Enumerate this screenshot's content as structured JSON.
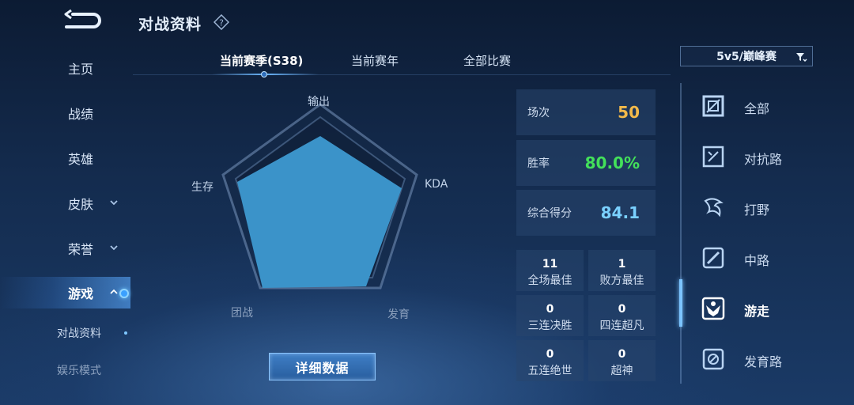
{
  "header": {
    "title": "对战资料"
  },
  "nav": {
    "items": [
      {
        "label": "主页"
      },
      {
        "label": "战绩"
      },
      {
        "label": "英雄"
      },
      {
        "label": "皮肤"
      },
      {
        "label": "荣誉"
      },
      {
        "label": "游戏"
      }
    ],
    "sub_items": [
      {
        "label": "对战资料"
      },
      {
        "label": "娱乐模式"
      }
    ]
  },
  "tabs": [
    {
      "label": "当前赛季(S38)"
    },
    {
      "label": "当前赛年"
    },
    {
      "label": "全部比赛"
    }
  ],
  "mode_select": {
    "value": "5v5/巅峰赛"
  },
  "radar": {
    "axes": [
      "输出",
      "KDA",
      "发育",
      "团战",
      "生存"
    ],
    "fill_color": "#3b93c9"
  },
  "detail_button": {
    "label": "详细数据"
  },
  "stats": {
    "matches": {
      "label": "场次",
      "value": "50",
      "color": "#f2b94a"
    },
    "win_rate": {
      "label": "胜率",
      "value": "80.0%",
      "color": "#43e05a"
    },
    "score": {
      "label": "综合得分",
      "value": "84.1",
      "color": "#7ad0ff"
    }
  },
  "achievements": [
    {
      "count": "11",
      "label": "全场最佳"
    },
    {
      "count": "1",
      "label": "败方最佳"
    },
    {
      "count": "0",
      "label": "三连决胜"
    },
    {
      "count": "0",
      "label": "四连超凡"
    },
    {
      "count": "0",
      "label": "五连绝世"
    },
    {
      "count": "0",
      "label": "超神"
    }
  ],
  "roles": [
    {
      "label": "全部",
      "icon": "all-roles-icon"
    },
    {
      "label": "对抗路",
      "icon": "clash-lane-icon"
    },
    {
      "label": "打野",
      "icon": "jungle-icon"
    },
    {
      "label": "中路",
      "icon": "mid-lane-icon"
    },
    {
      "label": "游走",
      "icon": "roam-icon"
    },
    {
      "label": "发育路",
      "icon": "farm-lane-icon"
    }
  ],
  "colors": {
    "accent": "#6ab8ff"
  }
}
